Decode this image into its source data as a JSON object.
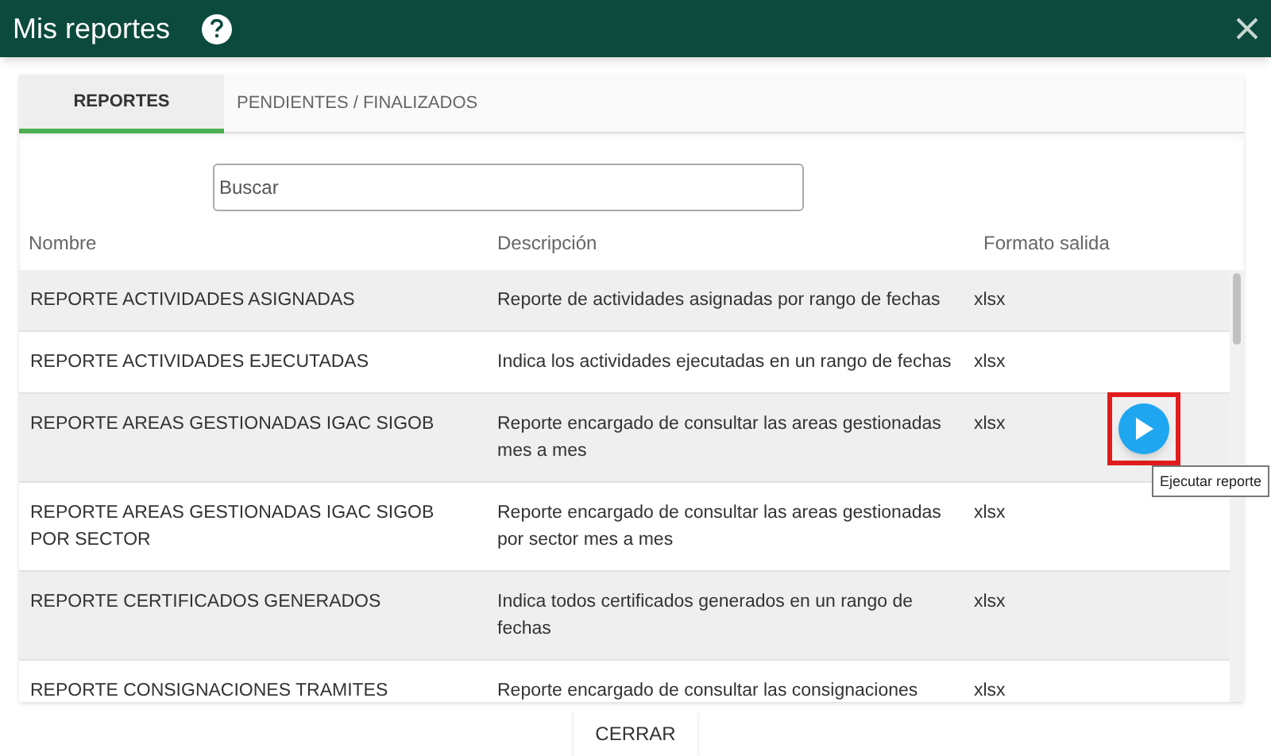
{
  "window": {
    "title": "Mis reportes",
    "help_icon": true
  },
  "tabs": [
    {
      "label": "REPORTES",
      "selected": true
    },
    {
      "label": "PENDIENTES / FINALIZADOS",
      "selected": false
    }
  ],
  "search": {
    "placeholder": "Buscar"
  },
  "table": {
    "columns": [
      "Nombre",
      "Descripción",
      "Formato salida"
    ],
    "rows": [
      {
        "name": "REPORTE ACTIVIDADES ASIGNADAS",
        "description": "Reporte de actividades asignadas por rango de fechas",
        "format": "xlsx",
        "show_action": false
      },
      {
        "name": "REPORTE ACTIVIDADES EJECUTADAS",
        "description": "Indica los actividades ejecutadas en un rango de fechas",
        "format": "xlsx",
        "show_action": false
      },
      {
        "name": "REPORTE AREAS GESTIONADAS IGAC SIGOB",
        "description": "Reporte encargado de consultar las areas gestionadas mes a mes",
        "format": "xlsx",
        "show_action": true,
        "action_highlighted": true,
        "tooltip": "Ejecutar reporte"
      },
      {
        "name": "REPORTE AREAS GESTIONADAS IGAC SIGOB POR SECTOR",
        "description": "Reporte encargado de consultar las areas gestionadas por sector mes a mes",
        "format": "xlsx",
        "show_action": false
      },
      {
        "name": "REPORTE CERTIFICADOS GENERADOS",
        "description": "Indica todos certificados generados en un rango de fechas",
        "format": "xlsx",
        "show_action": false
      },
      {
        "name": "REPORTE CONSIGNACIONES TRAMITES",
        "description": "Reporte encargado de consultar las consignaciones",
        "format": "xlsx",
        "show_action": false
      }
    ]
  },
  "close_button": "CERRAR"
}
